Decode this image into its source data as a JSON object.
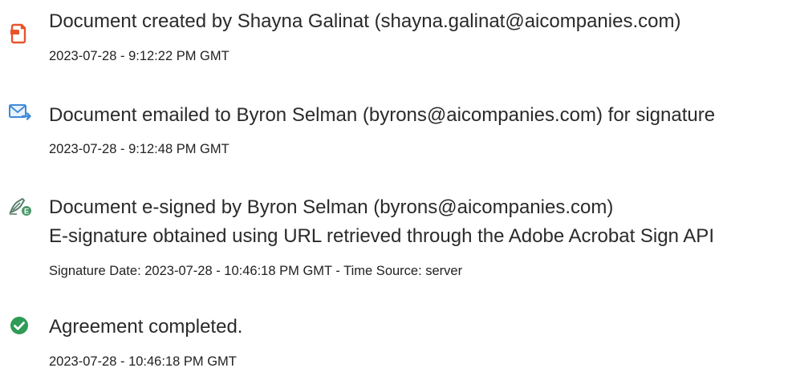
{
  "events": [
    {
      "icon": "document-created-icon",
      "text": "Document created by Shayna Galinat (shayna.galinat@aicompanies.com)",
      "timestamp": "2023-07-28 - 9:12:22 PM GMT"
    },
    {
      "icon": "email-sent-icon",
      "text": "Document emailed to Byron Selman (byrons@aicompanies.com) for signature",
      "timestamp": "2023-07-28 - 9:12:48 PM GMT"
    },
    {
      "icon": "e-sign-pen-icon",
      "text": "Document e-signed by Byron Selman (byrons@aicompanies.com)",
      "detail": "E-signature obtained using URL retrieved through the Adobe Acrobat Sign API",
      "timestamp": "Signature Date: 2023-07-28 - 10:46:18 PM GMT - Time Source: server"
    },
    {
      "icon": "check-circle-icon",
      "text": "Agreement completed.",
      "timestamp": "2023-07-28 - 10:46:18 PM GMT"
    }
  ],
  "colors": {
    "created_accent": "#e8542a",
    "email_accent": "#3f8ad8",
    "sign_accent": "#4a9a6a",
    "completed_accent": "#2e9b57"
  }
}
